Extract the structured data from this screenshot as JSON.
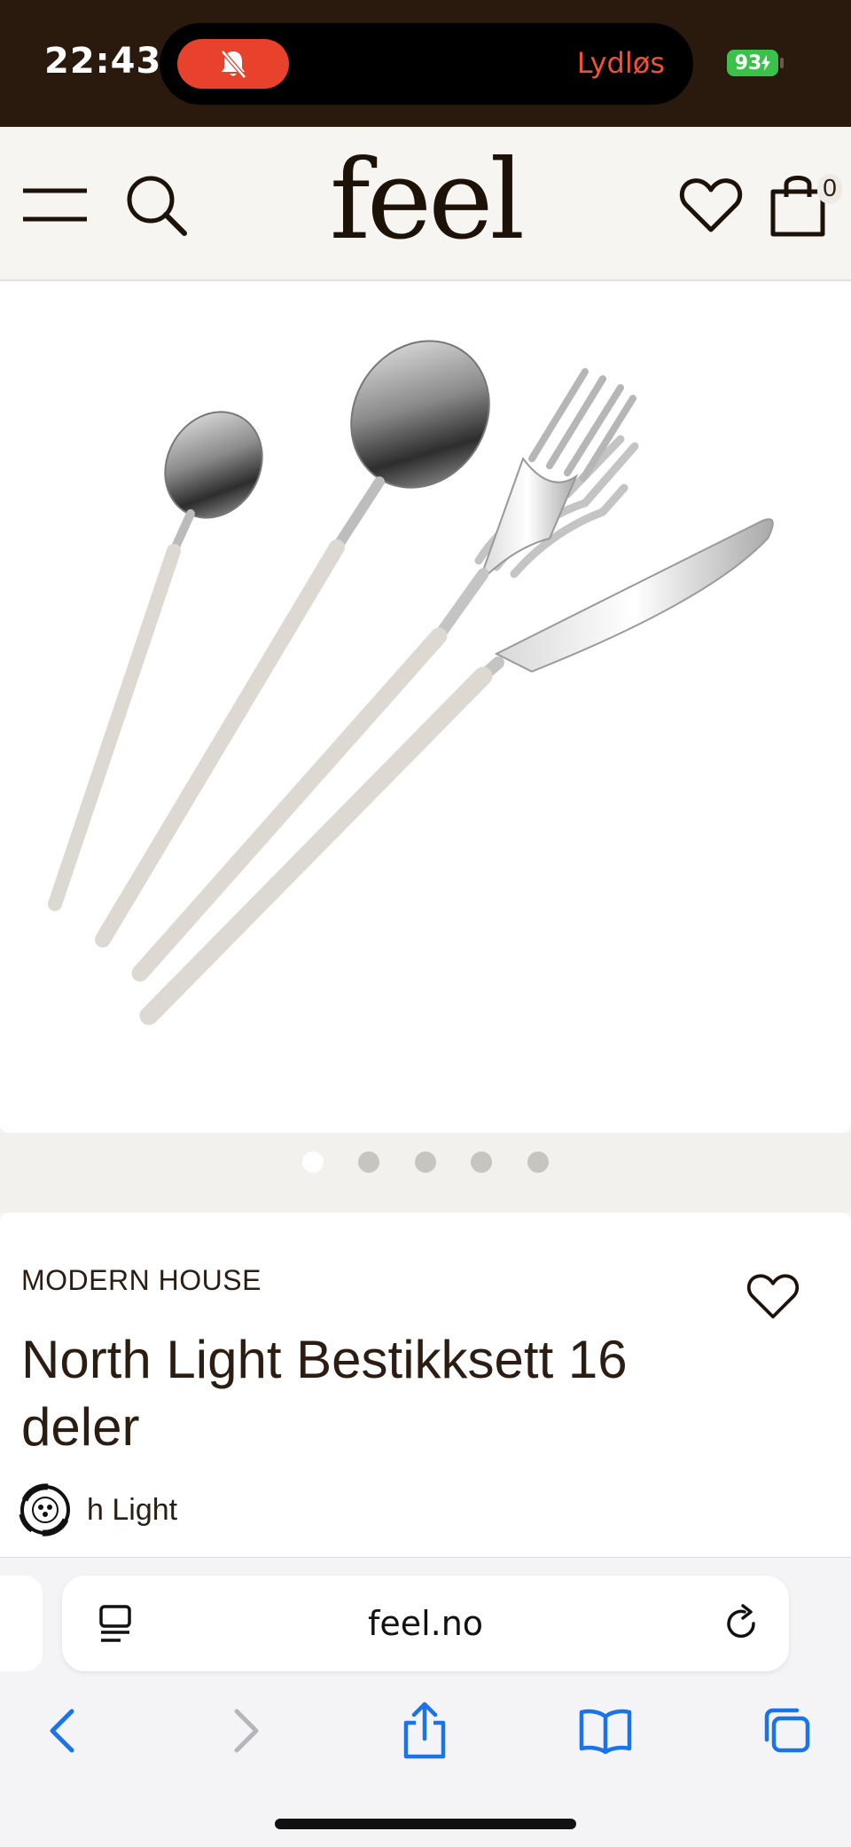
{
  "status_bar": {
    "time": "22:43",
    "silent_label": "Lydløs",
    "battery": "93",
    "mute_icon": "bell-slash-icon"
  },
  "header": {
    "logo": "feel",
    "cart_count": "0",
    "icons": [
      "menu-icon",
      "search-icon",
      "heart-icon",
      "shopping-bag-icon"
    ]
  },
  "gallery": {
    "image_alt": "cutlery set: teaspoon, spoon, fork, knife",
    "slide_count": 5,
    "active_index": 0
  },
  "product": {
    "brand": "MODERN HOUSE",
    "title": "North Light Bestikksett 16 deler",
    "series_label": "h Light"
  },
  "browser": {
    "url": "feel.no",
    "toolbar": [
      "back-icon",
      "forward-icon",
      "share-icon",
      "bookmarks-icon",
      "tabs-icon"
    ]
  },
  "colors": {
    "brand_dark": "#2b1d12",
    "status_bg": "#2a1a0e",
    "silent_red": "#e8412c",
    "battery_green": "#3bc14a",
    "safari_blue": "#1a73e8"
  }
}
